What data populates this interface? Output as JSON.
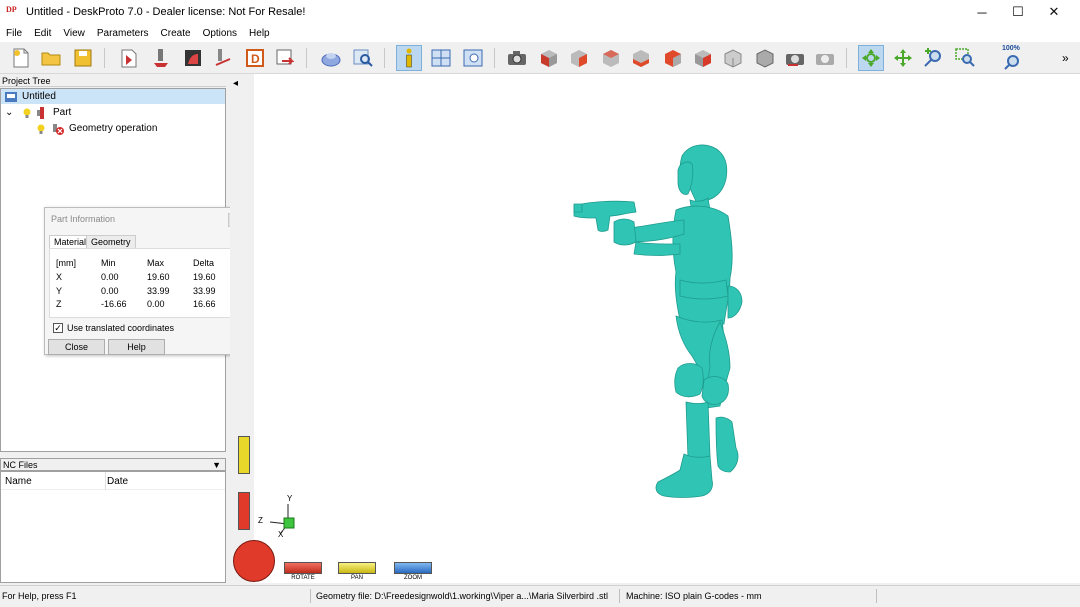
{
  "window": {
    "title": "Untitled - DeskProto 7.0 - Dealer license: Not For Resale!",
    "app_icon_text": "DP",
    "minimize": "─",
    "maximize": "☐",
    "close": "✕"
  },
  "menu": {
    "items": [
      "File",
      "Edit",
      "View",
      "Parameters",
      "Create",
      "Options",
      "Help"
    ]
  },
  "toolbar": {
    "overflow": "»",
    "zoom_label": "100%"
  },
  "project_tree": {
    "header": "Project Tree",
    "root": "Untitled",
    "part": "Part",
    "operation": "Geometry operation",
    "expander": "⌄"
  },
  "part_info": {
    "title": "Part Information",
    "tabs": [
      "Material",
      "Geometry"
    ],
    "columns": [
      "[mm]",
      "Min",
      "Max",
      "Delta"
    ],
    "rows": [
      [
        "X",
        "0.00",
        "19.60",
        "19.60"
      ],
      [
        "Y",
        "0.00",
        "33.99",
        "33.99"
      ],
      [
        "Z",
        "-16.66",
        "0.00",
        "16.66"
      ]
    ],
    "checkbox_label": "Use translated coordinates",
    "checkbox_mark": "✓",
    "close_button": "Close",
    "help_button": "Help",
    "more_arrow": "▼"
  },
  "nc_files": {
    "header": "NC Files",
    "dropdown": "▼",
    "columns": [
      "Name",
      "Date"
    ]
  },
  "viewport": {
    "collapse_arrow": "◂",
    "axes": {
      "x": "X",
      "y": "Y",
      "z": "Z"
    },
    "modes": [
      "ROTATE",
      "PAN",
      "ZOOM"
    ],
    "colors": {
      "model": "#2fc4b4",
      "rotate": "#e03a2a",
      "pan": "#e8d82a",
      "zoom": "#3a8de0"
    }
  },
  "status": {
    "help": "For Help, press F1",
    "geometry_file": "Geometry file: D:\\Freedesignwold\\1.working\\Viper a...\\Maria Silverbird .stl",
    "machine": "Machine: ISO plain G-codes - mm"
  }
}
